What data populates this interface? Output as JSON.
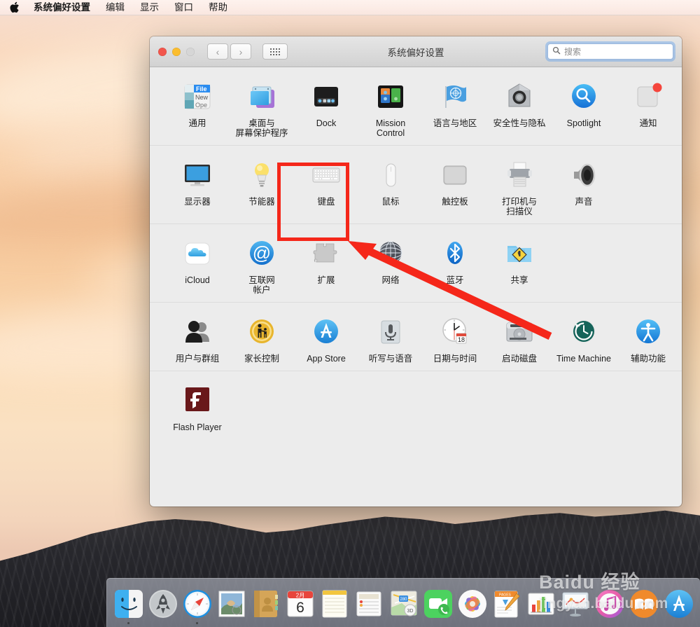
{
  "menubar": {
    "apple_icon": "apple-logo-icon",
    "items": [
      {
        "label": "系统偏好设置",
        "bold": true
      },
      {
        "label": "编辑"
      },
      {
        "label": "显示"
      },
      {
        "label": "窗口"
      },
      {
        "label": "帮助"
      }
    ]
  },
  "window": {
    "title": "系统偏好设置",
    "traffic_lights": [
      "close-red",
      "minimize-yellow",
      "zoom-disabled"
    ],
    "nav": {
      "back": "‹",
      "forward": "›"
    },
    "grid_button": "show-all-grid-icon",
    "search": {
      "placeholder": "搜索",
      "value": "",
      "icon": "search-icon",
      "focused": true
    }
  },
  "rows": [
    {
      "items": [
        {
          "label": "通用",
          "icon": "general-icon"
        },
        {
          "label": "桌面与\n屏幕保护程序",
          "icon": "desktop-screensaver-icon"
        },
        {
          "label": "Dock",
          "icon": "dock-icon"
        },
        {
          "label": "Mission\nControl",
          "icon": "mission-control-icon"
        },
        {
          "label": "语言与地区",
          "icon": "language-region-icon"
        },
        {
          "label": "安全性与隐私",
          "icon": "security-privacy-icon"
        },
        {
          "label": "Spotlight",
          "icon": "spotlight-icon"
        },
        {
          "label": "通知",
          "icon": "notifications-icon"
        }
      ]
    },
    {
      "items": [
        {
          "label": "显示器",
          "icon": "displays-icon"
        },
        {
          "label": "节能器",
          "icon": "energy-saver-icon"
        },
        {
          "label": "键盘",
          "icon": "keyboard-icon",
          "highlighted": true
        },
        {
          "label": "鼠标",
          "icon": "mouse-icon"
        },
        {
          "label": "触控板",
          "icon": "trackpad-icon"
        },
        {
          "label": "打印机与\n扫描仪",
          "icon": "printers-scanners-icon"
        },
        {
          "label": "声音",
          "icon": "sound-icon"
        }
      ]
    },
    {
      "items": [
        {
          "label": "iCloud",
          "icon": "icloud-icon"
        },
        {
          "label": "互联网\n帐户",
          "icon": "internet-accounts-icon"
        },
        {
          "label": "扩展",
          "icon": "extensions-icon"
        },
        {
          "label": "网络",
          "icon": "network-icon"
        },
        {
          "label": "蓝牙",
          "icon": "bluetooth-icon"
        },
        {
          "label": "共享",
          "icon": "sharing-icon"
        }
      ]
    },
    {
      "items": [
        {
          "label": "用户与群组",
          "icon": "users-groups-icon"
        },
        {
          "label": "家长控制",
          "icon": "parental-controls-icon"
        },
        {
          "label": "App Store",
          "icon": "app-store-icon"
        },
        {
          "label": "听写与语音",
          "icon": "dictation-speech-icon"
        },
        {
          "label": "日期与时间",
          "icon": "date-time-icon"
        },
        {
          "label": "启动磁盘",
          "icon": "startup-disk-icon"
        },
        {
          "label": "Time Machine",
          "icon": "time-machine-icon"
        },
        {
          "label": "辅助功能",
          "icon": "accessibility-icon"
        }
      ]
    },
    {
      "items": [
        {
          "label": "Flash Player",
          "icon": "flash-player-icon"
        }
      ]
    }
  ],
  "annotation": {
    "box_color": "#f5271a",
    "arrow_color": "#f5271a",
    "target_label": "键盘"
  },
  "date_icon": {
    "month": "2月",
    "day": "6"
  },
  "dock": {
    "items": [
      {
        "name": "finder",
        "running": true
      },
      {
        "name": "launchpad",
        "running": false
      },
      {
        "name": "safari",
        "running": true
      },
      {
        "name": "mail",
        "running": false
      },
      {
        "name": "contacts",
        "running": false
      },
      {
        "name": "calendar",
        "running": false
      },
      {
        "name": "notes",
        "running": false
      },
      {
        "name": "reminders",
        "running": false
      },
      {
        "name": "maps",
        "running": false
      },
      {
        "name": "facetime",
        "running": false
      },
      {
        "name": "photos",
        "running": false
      },
      {
        "name": "pages",
        "running": false
      },
      {
        "name": "numbers",
        "running": false
      },
      {
        "name": "keynote",
        "running": false
      },
      {
        "name": "itunes",
        "running": false
      },
      {
        "name": "ibooks",
        "running": false
      },
      {
        "name": "app-store",
        "running": false
      }
    ]
  },
  "watermark": {
    "main": "Baidu 经验",
    "url": "jingyan.baidu.com"
  }
}
